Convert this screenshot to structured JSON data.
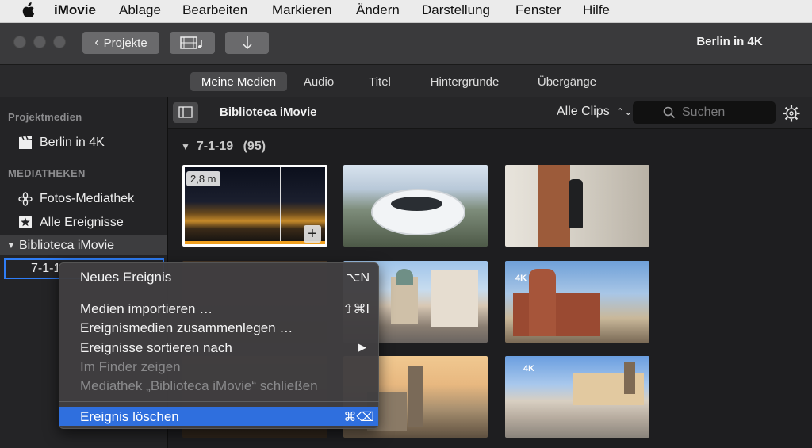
{
  "menubar": {
    "app": "iMovie",
    "items": [
      "Ablage",
      "Bearbeiten",
      "Markieren",
      "Ändern",
      "Darstellung",
      "Fenster",
      "Hilfe"
    ]
  },
  "toolbar": {
    "back_label": "Projekte",
    "project_title": "Berlin in 4K"
  },
  "tabs": [
    "Meine Medien",
    "Audio",
    "Titel",
    "Hintergründe",
    "Übergänge"
  ],
  "sidebar": {
    "section1": "Projektmedien",
    "project": "Berlin in 4K",
    "section2": "MEDIATHEKEN",
    "items": [
      "Fotos-Mediathek",
      "Alle Ereignisse"
    ],
    "library": "Biblioteca iMovie",
    "event": "7-1-19"
  },
  "browser": {
    "library_title": "Biblioteca iMovie",
    "filter": "Alle Clips",
    "search_placeholder": "Suchen",
    "event_header": "7-1-19",
    "event_count": "(95)",
    "duration": "2,8 m",
    "badges": [
      "4K",
      "4K"
    ]
  },
  "context_menu": {
    "items": [
      {
        "label": "Neues Ereignis",
        "shortcut": "⌥N",
        "enabled": true
      },
      {
        "label": "Medien importieren …",
        "shortcut": "⇧⌘I",
        "enabled": true
      },
      {
        "label": "Ereignismedien zusammenlegen …",
        "shortcut": "",
        "enabled": true
      },
      {
        "label": "Ereignisse sortieren nach",
        "shortcut": "▶",
        "enabled": true
      },
      {
        "label": "Im Finder zeigen",
        "shortcut": "",
        "enabled": false
      },
      {
        "label": "Mediathek „Biblioteca iMovie“ schließen",
        "shortcut": "",
        "enabled": false
      },
      {
        "label": "Ereignis löschen",
        "shortcut": "⌘⌫",
        "enabled": true,
        "highlighted": true
      }
    ]
  },
  "colors": {
    "accent": "#2f6fde",
    "selection_border": "#2f7df5"
  }
}
